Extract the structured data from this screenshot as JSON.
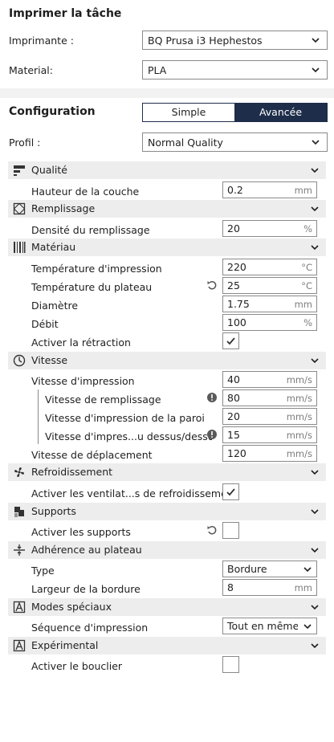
{
  "print_job": {
    "title": "Imprimer la tâche",
    "printer_label": "Imprimante :",
    "printer_value": "BQ Prusa i3 Hephestos",
    "material_label": "Material:",
    "material_value": "PLA"
  },
  "configuration": {
    "title": "Configuration",
    "mode_simple": "Simple",
    "mode_advanced": "Avancée",
    "profile_label": "Profil :",
    "profile_value": "Normal Quality"
  },
  "categories": {
    "quality": "Qualité",
    "infill": "Remplissage",
    "material": "Matériau",
    "speed": "Vitesse",
    "cooling": "Refroidissement",
    "support": "Supports",
    "adhesion": "Adhérence au plateau",
    "special": "Modes spéciaux",
    "experimental": "Expérimental"
  },
  "settings": {
    "layer_height": {
      "label": "Hauteur de la couche",
      "value": "0.2",
      "unit": "mm"
    },
    "infill_density": {
      "label": "Densité du remplissage",
      "value": "20",
      "unit": "%"
    },
    "print_temp": {
      "label": "Température d'impression",
      "value": "220",
      "unit": "°C"
    },
    "bed_temp": {
      "label": "Température du plateau",
      "value": "25",
      "unit": "°C"
    },
    "diameter": {
      "label": "Diamètre",
      "value": "1.75",
      "unit": "mm"
    },
    "flow": {
      "label": "Débit",
      "value": "100",
      "unit": "%"
    },
    "retraction": {
      "label": "Activer la rétraction",
      "checked": true
    },
    "print_speed": {
      "label": "Vitesse d'impression",
      "value": "40",
      "unit": "mm/s"
    },
    "infill_speed": {
      "label": "Vitesse de remplissage",
      "value": "80",
      "unit": "mm/s"
    },
    "wall_speed": {
      "label": "Vitesse d'impression de la paroi",
      "value": "20",
      "unit": "mm/s"
    },
    "topbottom_speed": {
      "label": "Vitesse d'impres...u dessus/dessous",
      "value": "15",
      "unit": "mm/s"
    },
    "travel_speed": {
      "label": "Vitesse de déplacement",
      "value": "120",
      "unit": "mm/s"
    },
    "fan_enable": {
      "label": "Activer les ventilat...s de refroidissement",
      "checked": true
    },
    "support_enable": {
      "label": "Activer les supports",
      "checked": false
    },
    "adhesion_type": {
      "label": "Type",
      "value": "Bordure"
    },
    "brim_width": {
      "label": "Largeur de la bordure",
      "value": "8",
      "unit": "mm"
    },
    "print_sequence": {
      "label": "Séquence d'impression",
      "value": "Tout en même..."
    },
    "ooze_shield": {
      "label": "Activer le bouclier",
      "checked": false
    }
  },
  "icons": {
    "chevron": "chevron-down-icon",
    "reset": "reset-icon",
    "warning": "warning-icon"
  },
  "colors": {
    "accent_dark": "#1e2d4a",
    "category_bg": "#ededed",
    "separator_bg": "#f2f2f2"
  }
}
